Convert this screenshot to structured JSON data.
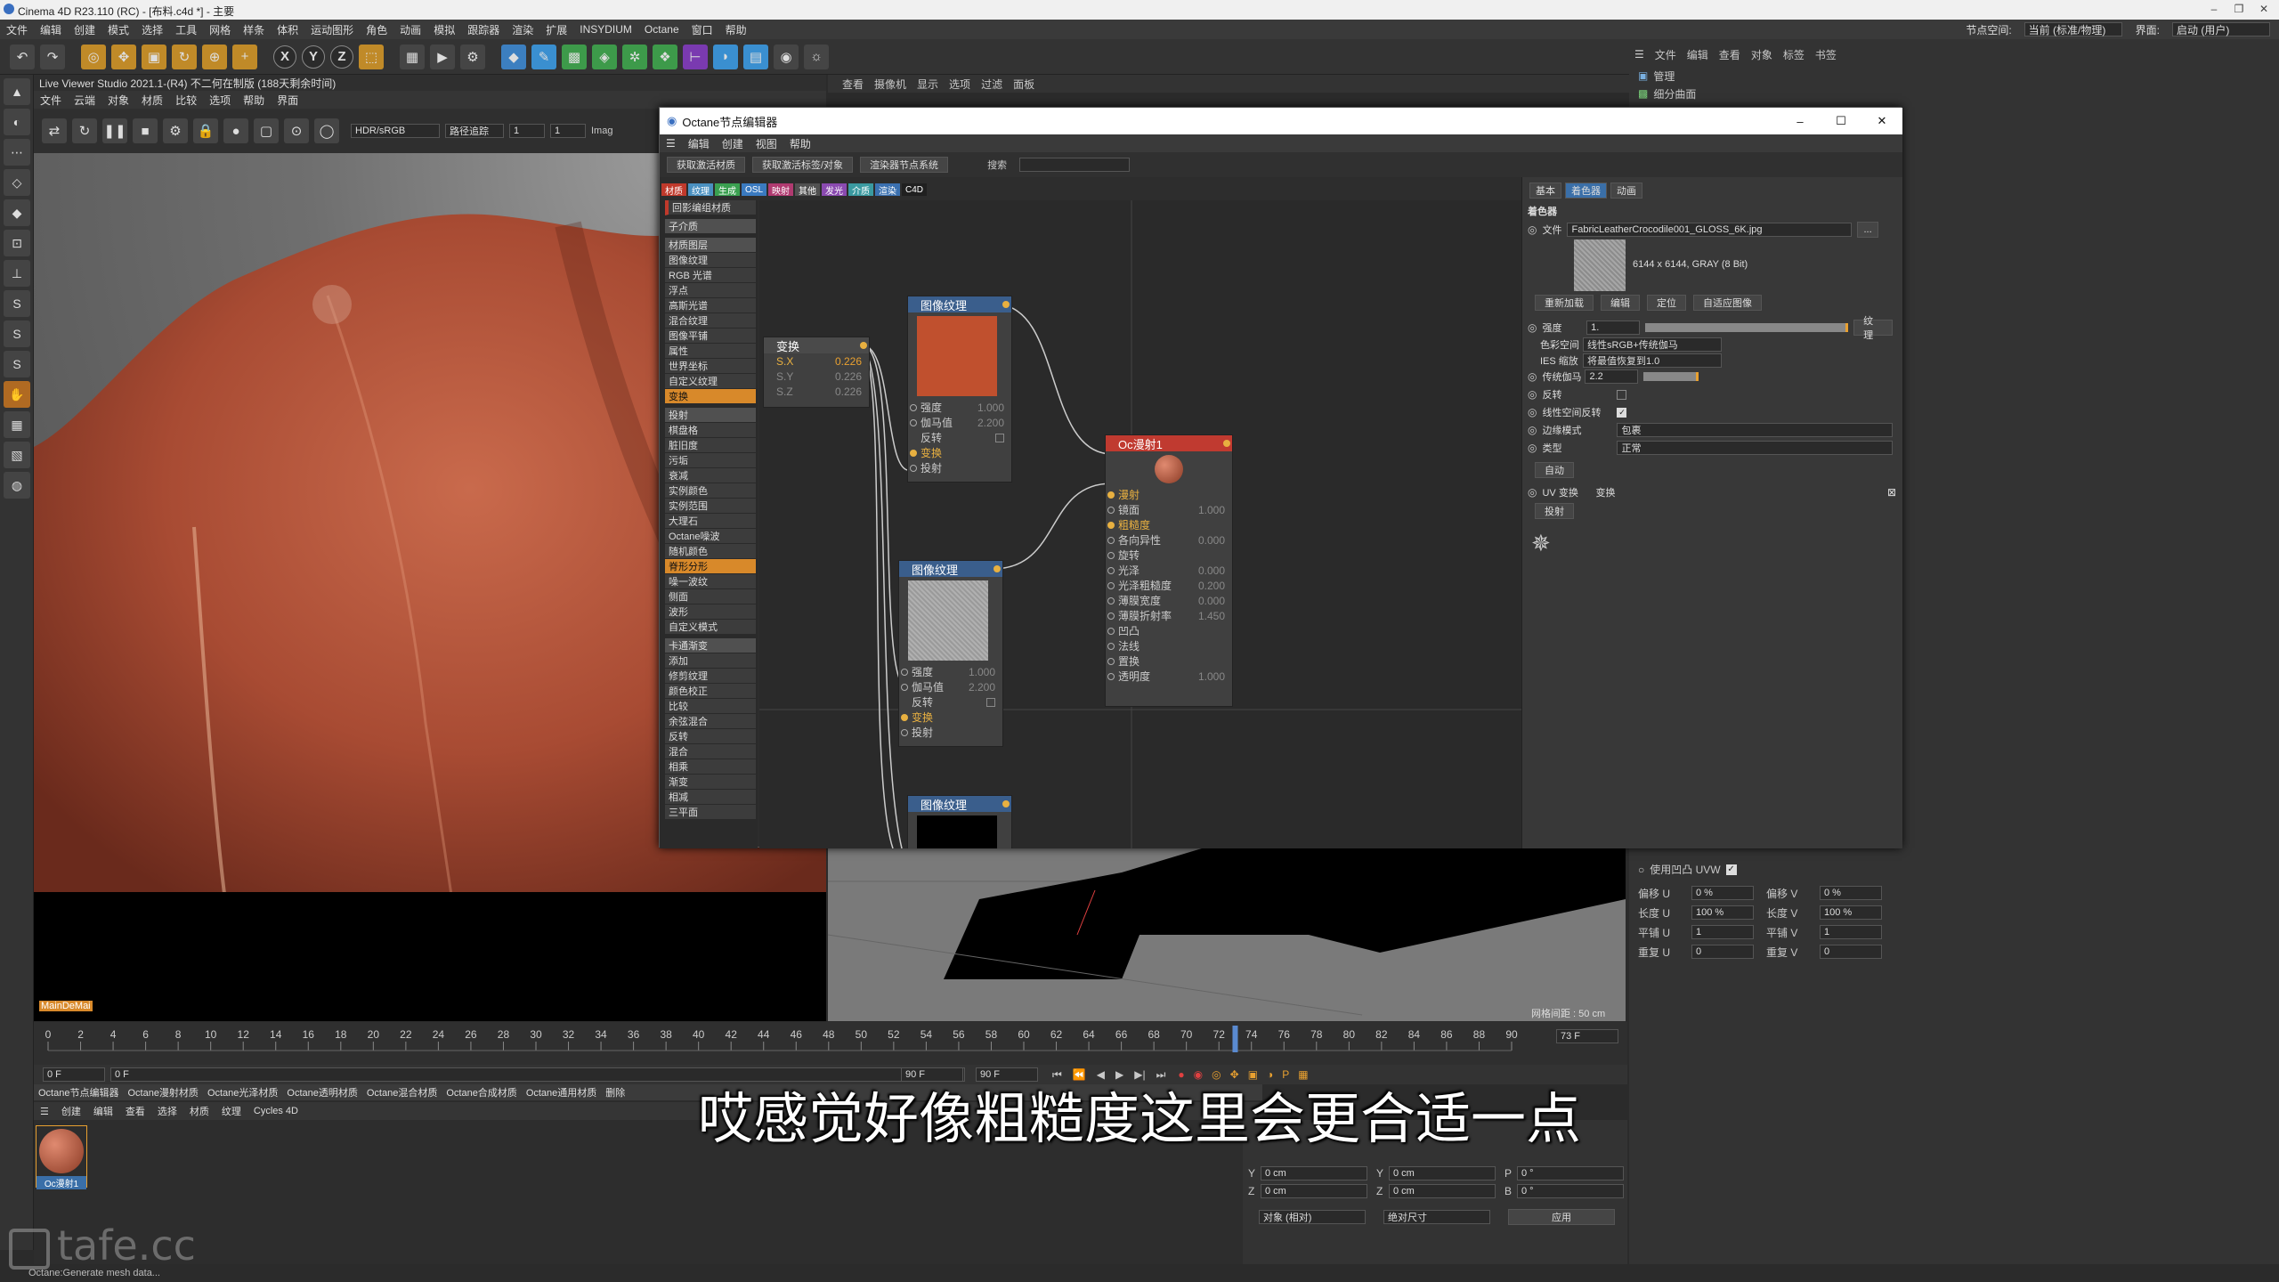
{
  "app": {
    "window_title": "Cinema 4D R23.110 (RC) - [布料.c4d *] - 主要",
    "menu": [
      "文件",
      "编辑",
      "创建",
      "模式",
      "选择",
      "工具",
      "网格",
      "样条",
      "体积",
      "运动图形",
      "角色",
      "动画",
      "模拟",
      "跟踪器",
      "渲染",
      "扩展",
      "INSYDIUM",
      "Octane",
      "窗口",
      "帮助"
    ],
    "node_space_label": "节点空间:",
    "node_space_value": "当前 (标准/物理)",
    "interface_label": "界面:",
    "interface_value": "启动 (用户)"
  },
  "toolbar": {
    "axis_x": "X",
    "axis_y": "Y",
    "axis_z": "Z"
  },
  "viewer": {
    "header": "Live Viewer Studio 2021.1-(R4)  不二何在制版 (188天剩余时间)",
    "menu": [
      "文件",
      "云端",
      "对象",
      "材质",
      "比较",
      "选项",
      "帮助",
      "界面"
    ],
    "color_space": "HDR/sRGB",
    "mode": "路径追踪",
    "val1": "1",
    "val2": "1",
    "imag_label": "Imag",
    "bottom_tag": "MainDeMai"
  },
  "objmgr": {
    "menu": [
      "文件",
      "编辑",
      "查看",
      "对象",
      "标签",
      "书签"
    ],
    "items": [
      "管理",
      "细分曲面"
    ]
  },
  "viewport2": {
    "menu": [
      "查看",
      "摄像机",
      "显示",
      "选项",
      "过滤",
      "面板"
    ],
    "grid_label": "网格间距 : 50 cm"
  },
  "octane": {
    "title": "Octane节点编辑器",
    "menu": [
      "编辑",
      "创建",
      "视图",
      "帮助"
    ],
    "buttons": [
      "获取激活材质",
      "获取激活标签/对象",
      "渲染器节点系统"
    ],
    "search_label": "搜索",
    "cat_tabs": [
      {
        "label": "材质",
        "color": "#c0392b"
      },
      {
        "label": "纹理",
        "color": "#4a90c0"
      },
      {
        "label": "生成",
        "color": "#3aa050"
      },
      {
        "label": "OSL",
        "color": "#3a7ac0"
      },
      {
        "label": "映射",
        "color": "#b03a70"
      },
      {
        "label": "其他",
        "color": "#505050"
      },
      {
        "label": "发光",
        "color": "#8a4ab0"
      },
      {
        "label": "介质",
        "color": "#3a9aa0"
      },
      {
        "label": "渲染",
        "color": "#3a70b0"
      },
      {
        "label": "C4D",
        "color": "#202020"
      }
    ],
    "node_list": [
      {
        "label": "回影编组材质",
        "hi": false
      },
      {
        "label": "子介质",
        "hi": false,
        "sec": true
      },
      {
        "label": "材质图层",
        "hi": false,
        "sec": true
      },
      {
        "label": "图像纹理",
        "hi": false
      },
      {
        "label": "RGB 光谱",
        "hi": false
      },
      {
        "label": "浮点",
        "hi": false
      },
      {
        "label": "高斯光谱",
        "hi": false
      },
      {
        "label": "混合纹理",
        "hi": false
      },
      {
        "label": "图像平铺",
        "hi": false
      },
      {
        "label": "属性",
        "hi": false
      },
      {
        "label": "世界坐标",
        "hi": false
      },
      {
        "label": "自定义纹理",
        "hi": false
      },
      {
        "label": "变换",
        "hi": true
      },
      {
        "label": "投射",
        "hi": false,
        "sec": true
      },
      {
        "label": "棋盘格",
        "hi": false
      },
      {
        "label": "脏旧度",
        "hi": false
      },
      {
        "label": "污垢",
        "hi": false
      },
      {
        "label": "衰减",
        "hi": false
      },
      {
        "label": "实例颜色",
        "hi": false
      },
      {
        "label": "实例范围",
        "hi": false
      },
      {
        "label": "大理石",
        "hi": false
      },
      {
        "label": "Octane噪波",
        "hi": false
      },
      {
        "label": "随机颜色",
        "hi": false
      },
      {
        "label": "脊形分形",
        "hi": true
      },
      {
        "label": "噪一波纹",
        "hi": false
      },
      {
        "label": "侧面",
        "hi": false
      },
      {
        "label": "波形",
        "hi": false
      },
      {
        "label": "自定义模式",
        "hi": false
      },
      {
        "label": "卡通渐变",
        "hi": false,
        "sec": true
      },
      {
        "label": "添加",
        "hi": false
      },
      {
        "label": "修剪纹理",
        "hi": false
      },
      {
        "label": "颜色校正",
        "hi": false
      },
      {
        "label": "比较",
        "hi": false
      },
      {
        "label": "余弦混合",
        "hi": false
      },
      {
        "label": "反转",
        "hi": false
      },
      {
        "label": "混合",
        "hi": false
      },
      {
        "label": "相乘",
        "hi": false
      },
      {
        "label": "渐变",
        "hi": false
      },
      {
        "label": "相减",
        "hi": false
      },
      {
        "label": "三平面",
        "hi": false
      }
    ],
    "nodes": {
      "transform": {
        "title": "变换",
        "rows": [
          {
            "l": "S.X",
            "v": "0.226"
          },
          {
            "l": "S.Y",
            "v": "0.226"
          },
          {
            "l": "S.Z",
            "v": "0.226"
          }
        ]
      },
      "img1": {
        "title": "图像纹理",
        "rows": [
          {
            "l": "强度",
            "v": "1.000"
          },
          {
            "l": "伽马值",
            "v": "2.200"
          },
          {
            "l": "反转",
            "v": ""
          },
          {
            "l": "变换",
            "v": ""
          },
          {
            "l": "投射",
            "v": ""
          }
        ]
      },
      "img2": {
        "title": "图像纹理",
        "rows": [
          {
            "l": "强度",
            "v": "1.000"
          },
          {
            "l": "伽马值",
            "v": "2.200"
          },
          {
            "l": "反转",
            "v": ""
          },
          {
            "l": "变换",
            "v": ""
          },
          {
            "l": "投射",
            "v": ""
          }
        ]
      },
      "img3": {
        "title": "图像纹理"
      },
      "glossy": {
        "title": "Oc漫射1",
        "rows": [
          {
            "l": "漫射",
            "v": ""
          },
          {
            "l": "镜面",
            "v": "1.000"
          },
          {
            "l": "粗糙度",
            "v": ""
          },
          {
            "l": "各向异性",
            "v": "0.000"
          },
          {
            "l": "旋转",
            "v": ""
          },
          {
            "l": "光泽",
            "v": "0.000"
          },
          {
            "l": "光泽粗糙度",
            "v": "0.200"
          },
          {
            "l": "薄膜宽度",
            "v": "0.000"
          },
          {
            "l": "薄膜折射率",
            "v": "1.450"
          },
          {
            "l": "凹凸",
            "v": ""
          },
          {
            "l": "法线",
            "v": ""
          },
          {
            "l": "置换",
            "v": ""
          },
          {
            "l": "透明度",
            "v": "1.000"
          }
        ]
      }
    },
    "attr": {
      "tabs": [
        "基本",
        "着色器",
        "动画"
      ],
      "section": "着色器",
      "file_label": "文件",
      "file_value": "FabricLeatherCrocodile001_GLOSS_6K.jpg",
      "file_btn": "...",
      "img_info": "6144 x 6144, GRAY (8 Bit)",
      "img_buttons": [
        "重新加载",
        "编辑",
        "定位",
        "自适应图像"
      ],
      "strength_label": "强度",
      "strength_value": "1.",
      "strength_btn": "纹理",
      "colorspace_label": "色彩空间",
      "colorspace_value": "线性sRGB+传统伽马",
      "ies_label": "IES 缩放",
      "ies_value": "将最值恢复到1.0",
      "gamma_label": "传统伽马",
      "gamma_value": "2.2",
      "invert_label": "反转",
      "linear_invert_label": "线性空间反转",
      "border_label": "边缘模式",
      "border_value": "包裹",
      "type_label": "类型",
      "type_value": "正常",
      "auto_btn": "自动",
      "uv_label": "UV 变换",
      "uv_value": "变换",
      "proj_btn": "投射"
    }
  },
  "rightattr": {
    "use_uvw_label": "使用凹凸 UVW",
    "rows": [
      {
        "a": "偏移 U",
        "av": "0 %",
        "b": "偏移 V",
        "bv": "0 %"
      },
      {
        "a": "长度 U",
        "av": "100 %",
        "b": "长度 V",
        "bv": "100 %"
      },
      {
        "a": "平铺 U",
        "av": "1",
        "b": "平铺 V",
        "bv": "1"
      },
      {
        "a": "重复 U",
        "av": "0",
        "b": "重复 V",
        "bv": "0"
      }
    ]
  },
  "timeline": {
    "ticks": [
      "0",
      "2",
      "4",
      "6",
      "8",
      "10",
      "12",
      "14",
      "16",
      "18",
      "20",
      "22",
      "24",
      "26",
      "28",
      "30",
      "32",
      "34",
      "36",
      "38",
      "40",
      "42",
      "44",
      "46",
      "48",
      "50",
      "52",
      "54",
      "56",
      "58",
      "60",
      "62",
      "64",
      "66",
      "68",
      "70",
      "72",
      "74",
      "76",
      "78",
      "80",
      "82",
      "84",
      "86",
      "88",
      "90"
    ],
    "current_frame_label": "73 F",
    "start": "0 F",
    "start2": "0 F",
    "end": "90 F",
    "end2": "90 F",
    "playhead_frame": 73
  },
  "material": {
    "tabs": [
      "Octane节点编辑器",
      "Octane漫射材质",
      "Octane光泽材质",
      "Octane透明材质",
      "Octane混合材质",
      "Octane合成材质",
      "Octane通用材质",
      "删除"
    ],
    "menu": [
      "创建",
      "编辑",
      "查看",
      "选择",
      "材质",
      "纹理",
      "Cycles 4D"
    ],
    "swatch_label": "Oc漫射1"
  },
  "coords": {
    "rows": [
      {
        "a": "Y",
        "av": "0 cm",
        "b": "Y",
        "bv": "0 cm",
        "c": "P",
        "cv": "0 °"
      },
      {
        "a": "Z",
        "av": "0 cm",
        "b": "Z",
        "bv": "0 cm",
        "c": "B",
        "cv": "0 °"
      }
    ],
    "mode1": "对象 (相对)",
    "mode2": "绝对尺寸",
    "apply": "应用"
  },
  "status": "Octane:Generate mesh data...",
  "subtitle": "哎感觉好像粗糙度这里会更合适一点",
  "watermark": "tafe.cc",
  "colors": {
    "accent_orange": "#d8892a",
    "node_blue": "#3a5e8c",
    "node_red": "#c03a30",
    "leather": "#b5533a"
  }
}
